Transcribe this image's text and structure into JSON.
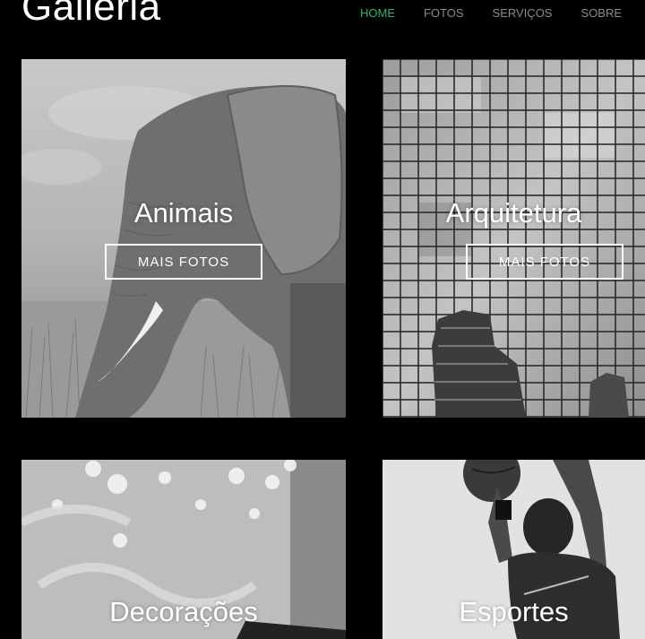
{
  "brand": {
    "logo_text": "Galleria"
  },
  "nav": {
    "items": [
      {
        "label": "HOME",
        "active": true
      },
      {
        "label": "FOTOS",
        "active": false
      },
      {
        "label": "SERVIÇOS",
        "active": false
      },
      {
        "label": "SOBRE",
        "active": false
      }
    ],
    "active_color": "#32b36f",
    "inactive_color": "#8a8a8a"
  },
  "gallery": {
    "cards": [
      {
        "title": "Animais",
        "button_label": "MAIS FOTOS",
        "image": "elephant-photo"
      },
      {
        "title": "Arquitetura",
        "button_label": "MAIS FOTOS",
        "image": "glass-building-photo"
      },
      {
        "title": "Decorações",
        "image": "decorations-photo"
      },
      {
        "title": "Esportes",
        "image": "basketball-player-photo"
      }
    ]
  }
}
